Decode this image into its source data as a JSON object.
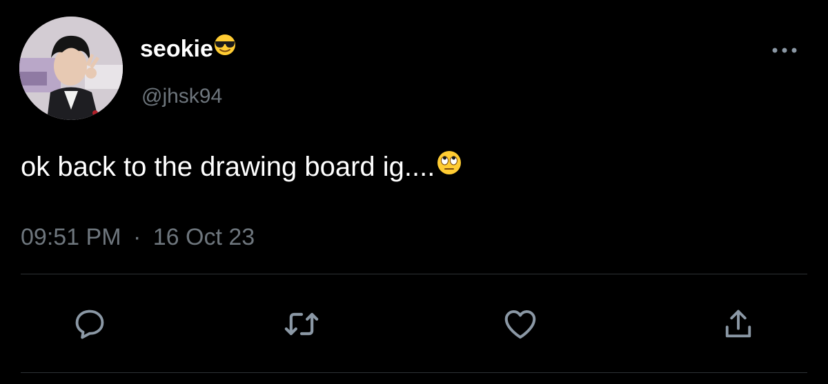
{
  "user": {
    "display_name": "seokie",
    "name_emoji": "smiling-face-with-sunglasses-emoji",
    "handle": "@jhsk94",
    "avatar": "profile-photo"
  },
  "tweet": {
    "text": "ok back to the drawing board ig....",
    "text_emoji": "face-with-rolling-eyes-emoji",
    "time": "09:51 PM",
    "separator": "·",
    "date": "16 Oct 23"
  },
  "actions": [
    {
      "icon": "reply-icon"
    },
    {
      "icon": "retweet-icon"
    },
    {
      "icon": "like-icon"
    },
    {
      "icon": "share-icon"
    }
  ],
  "menu": {
    "icon": "more-options-icon"
  },
  "colors": {
    "background": "#000000",
    "text": "#ffffff",
    "secondary": "#6e767d",
    "divider": "#2f3336",
    "icon": "#8b98a5"
  }
}
